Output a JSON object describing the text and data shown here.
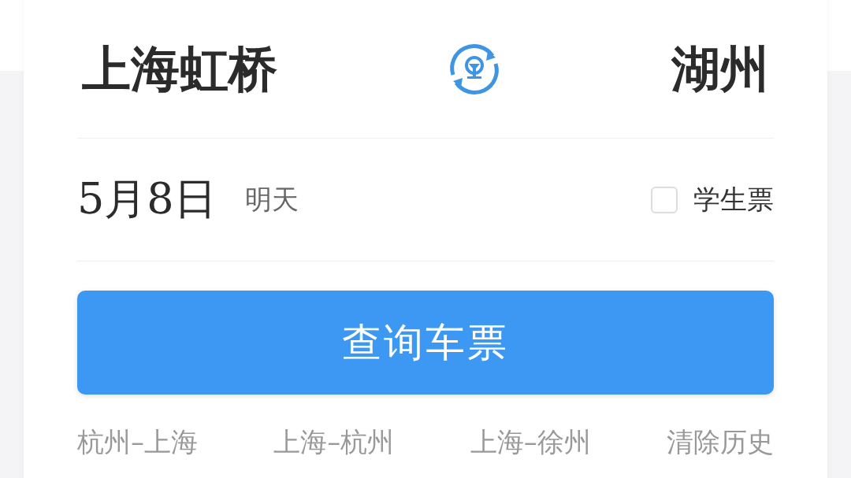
{
  "route": {
    "from": "上海虹桥",
    "to": "湖州"
  },
  "date": {
    "value": "5月8日",
    "hint": "明天"
  },
  "student_ticket": {
    "label": "学生票",
    "checked": false
  },
  "search_button": "查询车票",
  "history": [
    "杭州–上海",
    "上海–杭州",
    "上海–徐州"
  ],
  "clear_history": "清除历史"
}
